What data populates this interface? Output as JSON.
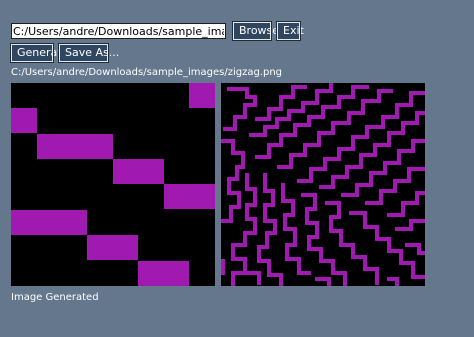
{
  "toolbar": {
    "path_value": "C:/Users/andre/Downloads/sample_images/zigzag.png",
    "browse_label": "Browse",
    "exit_label": "Exit",
    "generate_label": "Generate",
    "save_as_label": "Save As..."
  },
  "file": {
    "path_label": "C:/Users/andre/Downloads/sample_images/zigzag.png"
  },
  "status": {
    "text": "Image Generated"
  },
  "colors": {
    "background": "#64778d",
    "button": "#2e4660",
    "pixel": "#a019b0",
    "canvas": "#000000"
  }
}
